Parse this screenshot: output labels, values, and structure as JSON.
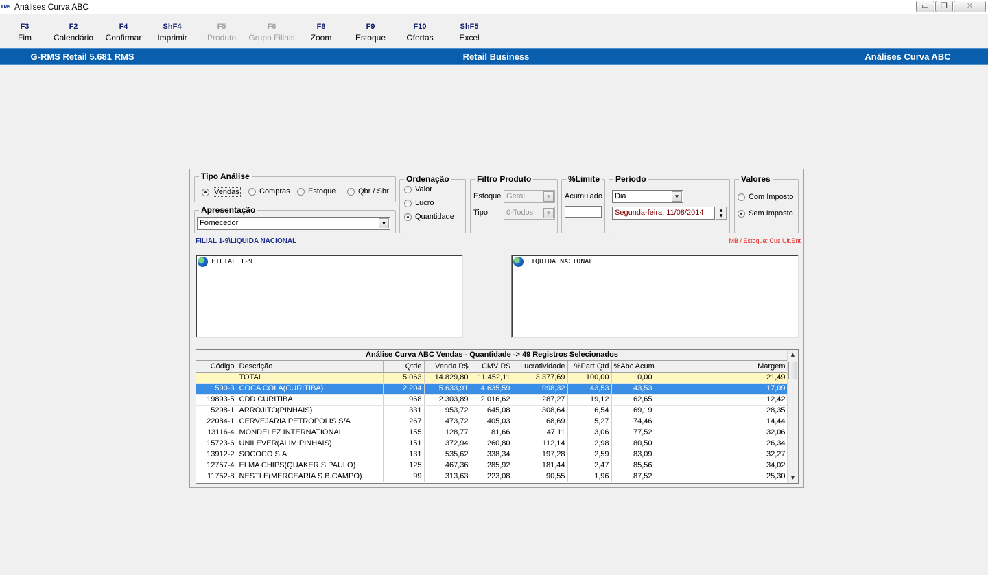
{
  "window": {
    "logo": "RMS",
    "title": "Análises Curva ABC",
    "controls": {
      "minimize": "▭",
      "restore": "❐",
      "close": "✕"
    }
  },
  "toolbar": [
    {
      "key": "F3",
      "label": "Fim",
      "enabled": true
    },
    {
      "key": "F2",
      "label": "Calendário",
      "enabled": true
    },
    {
      "key": "F4",
      "label": "Confirmar",
      "enabled": true
    },
    {
      "key": "ShF4",
      "label": "Imprimir",
      "enabled": true
    },
    {
      "key": "F5",
      "label": "Produto",
      "enabled": false
    },
    {
      "key": "F6",
      "label": "Grupo Filiais",
      "enabled": false
    },
    {
      "key": "F8",
      "label": "Zoom",
      "enabled": true
    },
    {
      "key": "F9",
      "label": "Estoque",
      "enabled": true
    },
    {
      "key": "F10",
      "label": "Ofertas",
      "enabled": true
    },
    {
      "key": "ShF5",
      "label": "Excel",
      "enabled": true
    }
  ],
  "header": {
    "left": "G-RMS Retail 5.681 RMS",
    "center": "Retail Business",
    "right": "Análises Curva ABC"
  },
  "tipo_analise": {
    "title": "Tipo Análise",
    "options": [
      "Vendas",
      "Compras",
      "Estoque",
      "Qbr / Sbr"
    ],
    "selected": "Vendas"
  },
  "apresentacao": {
    "title": "Apresentação",
    "value": "Fornecedor"
  },
  "ordenacao": {
    "title": "Ordenação",
    "options": [
      "Valor",
      "Lucro",
      "Quantidade"
    ],
    "selected": "Quantidade"
  },
  "filtro_produto": {
    "title": "Filtro Produto",
    "estoque_label": "Estoque",
    "estoque_value": "Geral",
    "tipo_label": "Tipo",
    "tipo_value": "0-Todos"
  },
  "limite": {
    "title": "%Limite",
    "label": "Acumulado",
    "value": ""
  },
  "periodo": {
    "title": "Período",
    "unit": "Dia",
    "date": "Segunda-feira, 11/08/2014"
  },
  "valores": {
    "title": "Valores",
    "options": [
      "Com Imposto",
      "Sem Imposto"
    ],
    "selected": "Sem Imposto"
  },
  "path_label": "FILIAL 1-9\\LIQUIDA NACIONAL",
  "mb_label": "MB / Estoque: Cus.Ult.Ent",
  "tree_left": {
    "node": "FILIAL 1-9"
  },
  "tree_right": {
    "node": "LIQUIDA NACIONAL"
  },
  "grid": {
    "caption": "Análise Curva ABC Vendas - Quantidade -> 49 Registros Selecionados",
    "columns": [
      "Código",
      "Descrição",
      "Qtde",
      "Venda R$",
      "CMV R$",
      "Lucratividade",
      "%Part Qtd",
      "%Abc Acum",
      "Margem"
    ],
    "rows": [
      {
        "codigo": "",
        "descricao": "TOTAL",
        "qtde": "5.063",
        "venda": "14.829,80",
        "cmv": "11.452,11",
        "lucr": "3.377,69",
        "part": "100,00",
        "abc": "0,00",
        "margem": "21,49"
      },
      {
        "codigo": "1590-3",
        "descricao": "COCA COLA(CURITIBA)",
        "qtde": "2.204",
        "venda": "5.633,91",
        "cmv": "4.635,59",
        "lucr": "998,32",
        "part": "43,53",
        "abc": "43,53",
        "margem": "17,09"
      },
      {
        "codigo": "19893-5",
        "descricao": "CDD CURITIBA",
        "qtde": "968",
        "venda": "2.303,89",
        "cmv": "2.016,62",
        "lucr": "287,27",
        "part": "19,12",
        "abc": "62,65",
        "margem": "12,42"
      },
      {
        "codigo": "5298-1",
        "descricao": "ARROJITO(PINHAIS)",
        "qtde": "331",
        "venda": "953,72",
        "cmv": "645,08",
        "lucr": "308,64",
        "part": "6,54",
        "abc": "69,19",
        "margem": "28,35"
      },
      {
        "codigo": "22084-1",
        "descricao": "CERVEJARIA PETROPOLIS S/A",
        "qtde": "267",
        "venda": "473,72",
        "cmv": "405,03",
        "lucr": "68,69",
        "part": "5,27",
        "abc": "74,46",
        "margem": "14,44"
      },
      {
        "codigo": "13116-4",
        "descricao": "MONDELEZ INTERNATIONAL",
        "qtde": "155",
        "venda": "128,77",
        "cmv": "81,66",
        "lucr": "47,11",
        "part": "3,06",
        "abc": "77,52",
        "margem": "32,06"
      },
      {
        "codigo": "15723-6",
        "descricao": "UNILEVER(ALIM.PINHAIS)",
        "qtde": "151",
        "venda": "372,94",
        "cmv": "260,80",
        "lucr": "112,14",
        "part": "2,98",
        "abc": "80,50",
        "margem": "26,34"
      },
      {
        "codigo": "13912-2",
        "descricao": "SOCOCO S.A",
        "qtde": "131",
        "venda": "535,62",
        "cmv": "338,34",
        "lucr": "197,28",
        "part": "2,59",
        "abc": "83,09",
        "margem": "32,27"
      },
      {
        "codigo": "12757-4",
        "descricao": "ELMA CHIPS(QUAKER S.PAULO)",
        "qtde": "125",
        "venda": "467,36",
        "cmv": "285,92",
        "lucr": "181,44",
        "part": "2,47",
        "abc": "85,56",
        "margem": "34,02"
      },
      {
        "codigo": "11752-8",
        "descricao": "NESTLE(MERCEARIA S.B.CAMPO)",
        "qtde": "99",
        "venda": "313,63",
        "cmv": "223,08",
        "lucr": "90,55",
        "part": "1,96",
        "abc": "87,52",
        "margem": "25,30"
      }
    ],
    "selected_row": 1
  },
  "colors": {
    "header_bar": "#0a5eae",
    "selection": "#3a8ee6",
    "total_row": "#fff8c0",
    "toolbar_key": "#101c6c",
    "path_label": "#1c2c8c",
    "mb_label": "#e02020"
  }
}
